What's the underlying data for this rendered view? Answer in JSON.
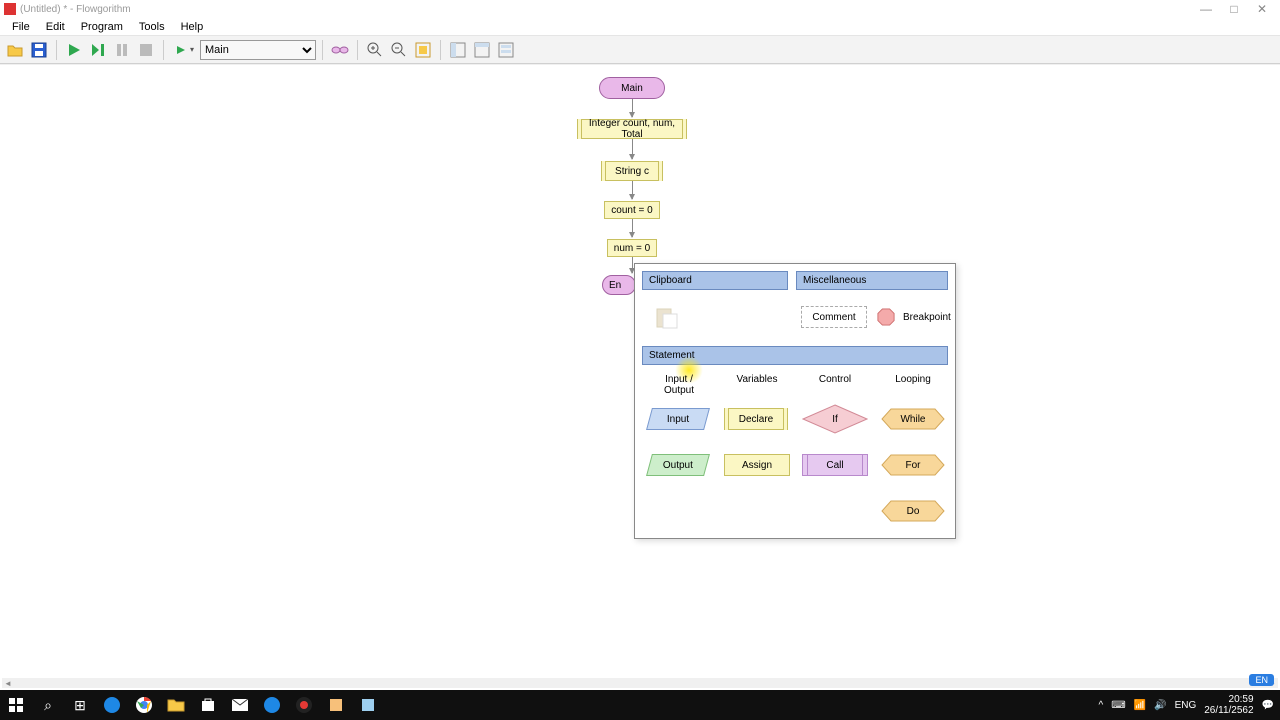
{
  "window": {
    "title": "(Untitled) * - Flowgorithm",
    "min": "—",
    "max": "□",
    "close": "✕"
  },
  "menu": [
    "File",
    "Edit",
    "Program",
    "Tools",
    "Help"
  ],
  "toolbar": {
    "function_selector": "Main"
  },
  "flowchart": {
    "main": "Main",
    "declare1": "Integer count, num, Total",
    "declare2": "String c",
    "assign1": "count = 0",
    "assign2": "num = 0",
    "end_partial": "En"
  },
  "popup": {
    "clipboard": "Clipboard",
    "miscellaneous": "Miscellaneous",
    "comment": "Comment",
    "breakpoint": "Breakpoint",
    "statement": "Statement",
    "cat_io": "Input / Output",
    "cat_vars": "Variables",
    "cat_control": "Control",
    "cat_loop": "Looping",
    "input": "Input",
    "output": "Output",
    "declare": "Declare",
    "assign": "Assign",
    "if": "If",
    "call": "Call",
    "while": "While",
    "for": "For",
    "do": "Do"
  },
  "taskbar": {
    "lang": "ENG",
    "time": "20:59",
    "date": "26/11/2562",
    "lang_badge": "EN"
  }
}
